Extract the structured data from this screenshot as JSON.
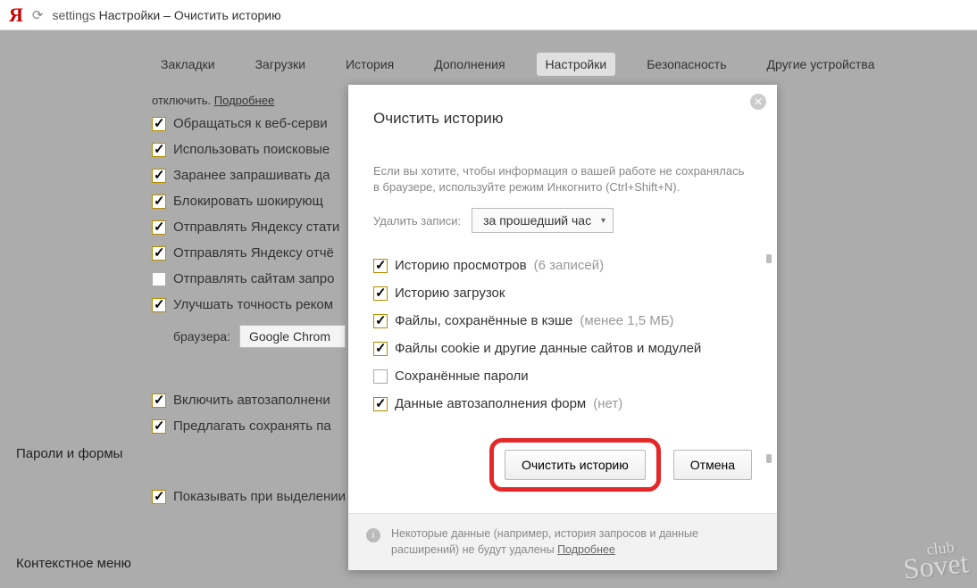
{
  "address": {
    "keyword": "settings",
    "title": "Настройки – Очистить историю"
  },
  "tabs": {
    "items": [
      "Закладки",
      "Загрузки",
      "История",
      "Дополнения",
      "Настройки",
      "Безопасность",
      "Другие устройства"
    ],
    "active": 4
  },
  "note": {
    "prefix": "отключить.",
    "link": "Подробнее"
  },
  "bg_options": [
    {
      "checked": true,
      "label": "Обращаться к веб-серви"
    },
    {
      "checked": true,
      "label": "Использовать поисковые"
    },
    {
      "checked": true,
      "label": "Заранее запрашивать да"
    },
    {
      "checked": true,
      "label": "Блокировать шокирующ"
    },
    {
      "checked": true,
      "label": "Отправлять Яндексу стати"
    },
    {
      "checked": true,
      "label": "Отправлять Яндексу отчё"
    },
    {
      "checked": false,
      "label": "Отправлять сайтам запро"
    },
    {
      "checked": true,
      "label": "Улучшать точность реком"
    }
  ],
  "browser_row": {
    "label": "браузера:",
    "value": "Google Chrom"
  },
  "sections": {
    "passwords": "Пароли и формы",
    "context": "Контекстное меню"
  },
  "pw_options": [
    {
      "checked": true,
      "label": "Включить автозаполнени"
    },
    {
      "checked": true,
      "label": "Предлагать сохранять па"
    }
  ],
  "ctx_option": {
    "checked": true,
    "label": "Показывать при выделении текста кнопки «Найти» и «Копировать»"
  },
  "dialog": {
    "title": "Очистить историю",
    "note": "Если вы хотите, чтобы информация о вашей работе не сохранялась в браузере, используйте режим Инкогнито (Ctrl+Shift+N).",
    "range_label": "Удалить записи:",
    "range_value": "за прошедший час",
    "items": [
      {
        "checked": true,
        "label": "Историю просмотров",
        "suffix": "(6 записей)"
      },
      {
        "checked": true,
        "label": "Историю загрузок",
        "suffix": ""
      },
      {
        "checked": true,
        "label": "Файлы, сохранённые в кэше",
        "suffix": "(менее 1,5 МБ)"
      },
      {
        "checked": true,
        "label": "Файлы cookie и другие данные сайтов и модулей",
        "suffix": ""
      },
      {
        "checked": false,
        "label": "Сохранённые пароли",
        "suffix": ""
      },
      {
        "checked": true,
        "label": "Данные автозаполнения форм",
        "suffix": "(нет)"
      }
    ],
    "clear_btn": "Очистить историю",
    "cancel_btn": "Отмена",
    "footer_text": "Некоторые данные (например, история запросов и данные расширений) не будут удалены",
    "footer_link": "Подробнее"
  },
  "watermark": {
    "top": "club",
    "main": "Sovet"
  }
}
